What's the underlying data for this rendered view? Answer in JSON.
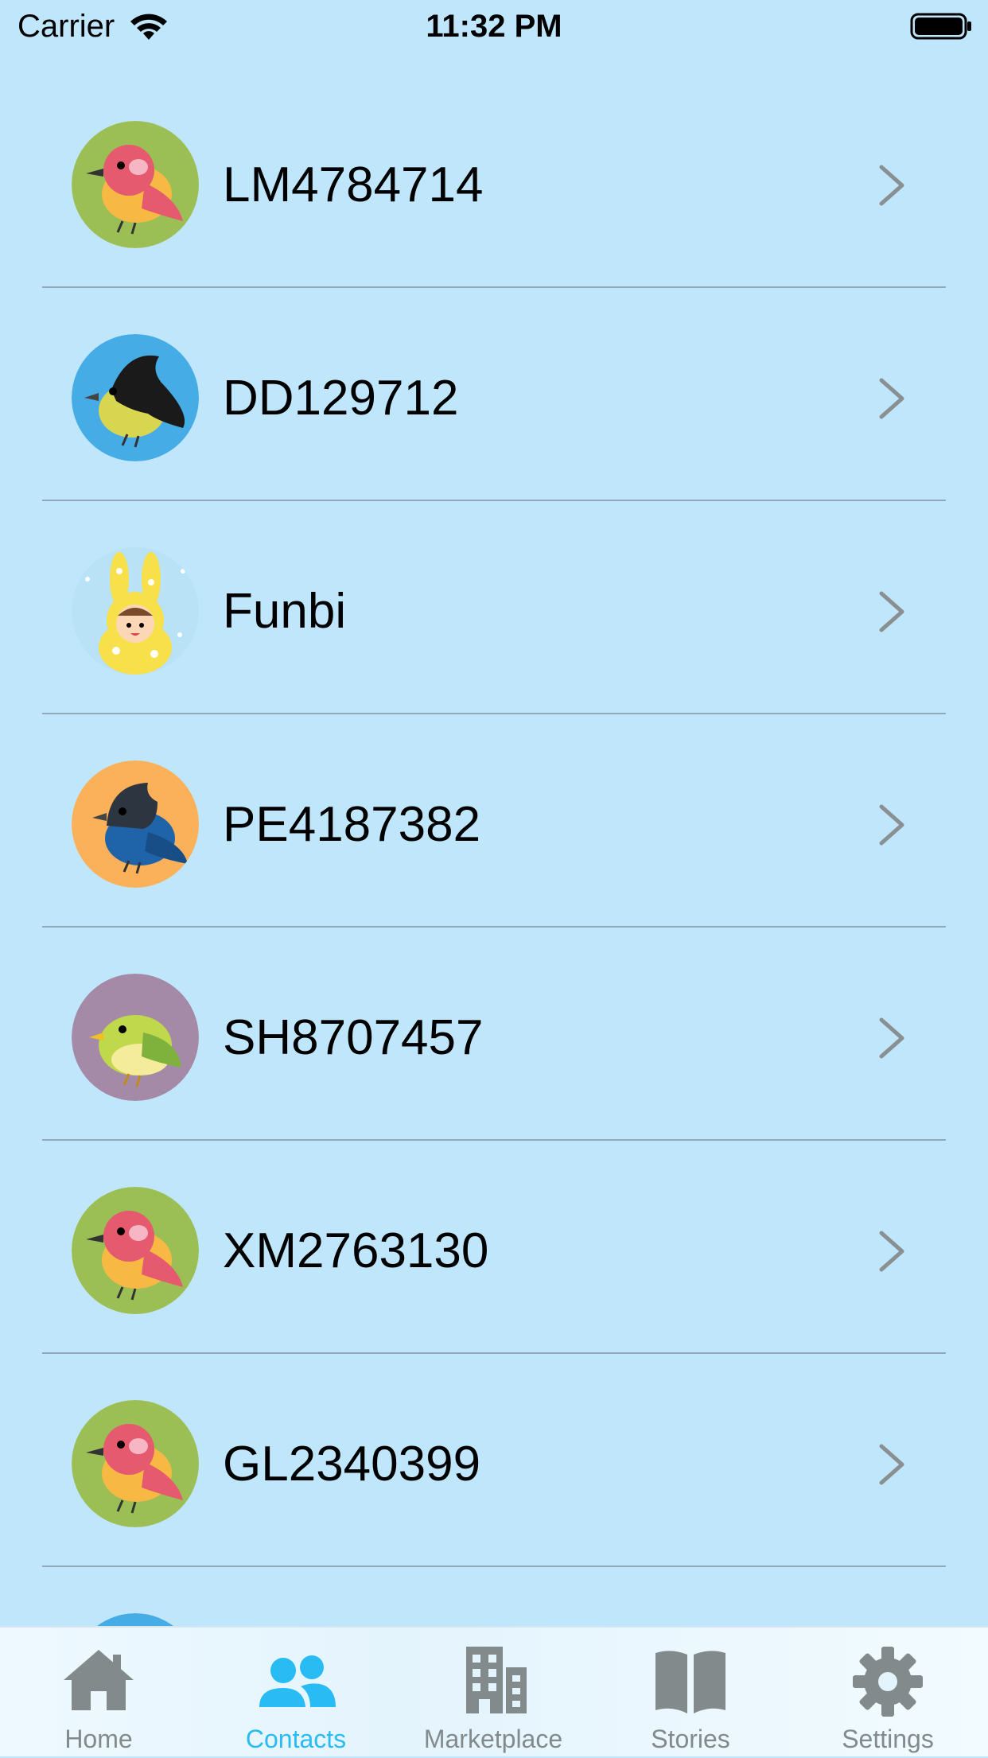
{
  "status_bar": {
    "carrier": "Carrier",
    "time": "11:32 PM",
    "wifi_icon": "wifi-icon",
    "battery_icon": "battery-full-icon"
  },
  "contacts": [
    {
      "name": "LM4784714",
      "avatar": "red-bird-green-bg"
    },
    {
      "name": "DD129712",
      "avatar": "black-bird-blue-bg"
    },
    {
      "name": "Funbi",
      "avatar": "bunny-kid-lightblue-bg"
    },
    {
      "name": "PE4187382",
      "avatar": "bluejay-orange-bg"
    },
    {
      "name": "SH8707457",
      "avatar": "green-bird-purple-bg"
    },
    {
      "name": "XM2763130",
      "avatar": "red-bird-green-bg"
    },
    {
      "name": "GL2340399",
      "avatar": "red-bird-green-bg"
    }
  ],
  "row_chevron_icon": "chevron-right-icon",
  "tab_bar": {
    "active_tab": "Contacts",
    "active_color": "#29bbf4",
    "inactive_color": "#838a8c",
    "tabs": [
      {
        "label": "Home",
        "icon": "house-icon"
      },
      {
        "label": "Contacts",
        "icon": "people-icon"
      },
      {
        "label": "Marketplace",
        "icon": "building-icon"
      },
      {
        "label": "Stories",
        "icon": "open-book-icon"
      },
      {
        "label": "Settings",
        "icon": "gear-icon"
      }
    ]
  },
  "colors": {
    "background": "#bfe6fb",
    "divider": "#8fa9b8",
    "chevron": "#8a8f91"
  }
}
